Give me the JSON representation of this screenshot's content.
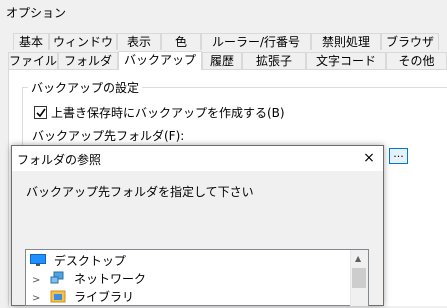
{
  "window": {
    "title": "オプション"
  },
  "tabs_row1": [
    "基本",
    "ウィンドウ",
    "表示",
    "色",
    "ルーラー/行番号",
    "禁則処理",
    "ブラウザ"
  ],
  "tabs_row2": [
    "ファイル",
    "フォルダ",
    "バックアップ",
    "履歴",
    "拡張子",
    "文字コード",
    "その他"
  ],
  "active_tab": "バックアップ",
  "backup": {
    "group_label": "バックアップの設定",
    "checkbox_label": "上書き保存時にバックアップを作成する(B)",
    "checkbox_checked": true,
    "folder_label": "バックアップ先フォルダ(F):",
    "browse_label": "..."
  },
  "dialog": {
    "title": "フォルダの参照",
    "close": "×",
    "message": "バックアップ先フォルダを指定して下さい",
    "tree": [
      {
        "label": "デスクトップ",
        "icon": "desktop-icon",
        "expander": ""
      },
      {
        "label": "ネットワーク",
        "icon": "network-icon",
        "expander": ">"
      },
      {
        "label": "ライブラリ",
        "icon": "library-icon",
        "expander": ">"
      }
    ]
  },
  "colors": {
    "accent": "#0078d7",
    "panel": "#ffffff",
    "background": "#f0f0f0"
  }
}
